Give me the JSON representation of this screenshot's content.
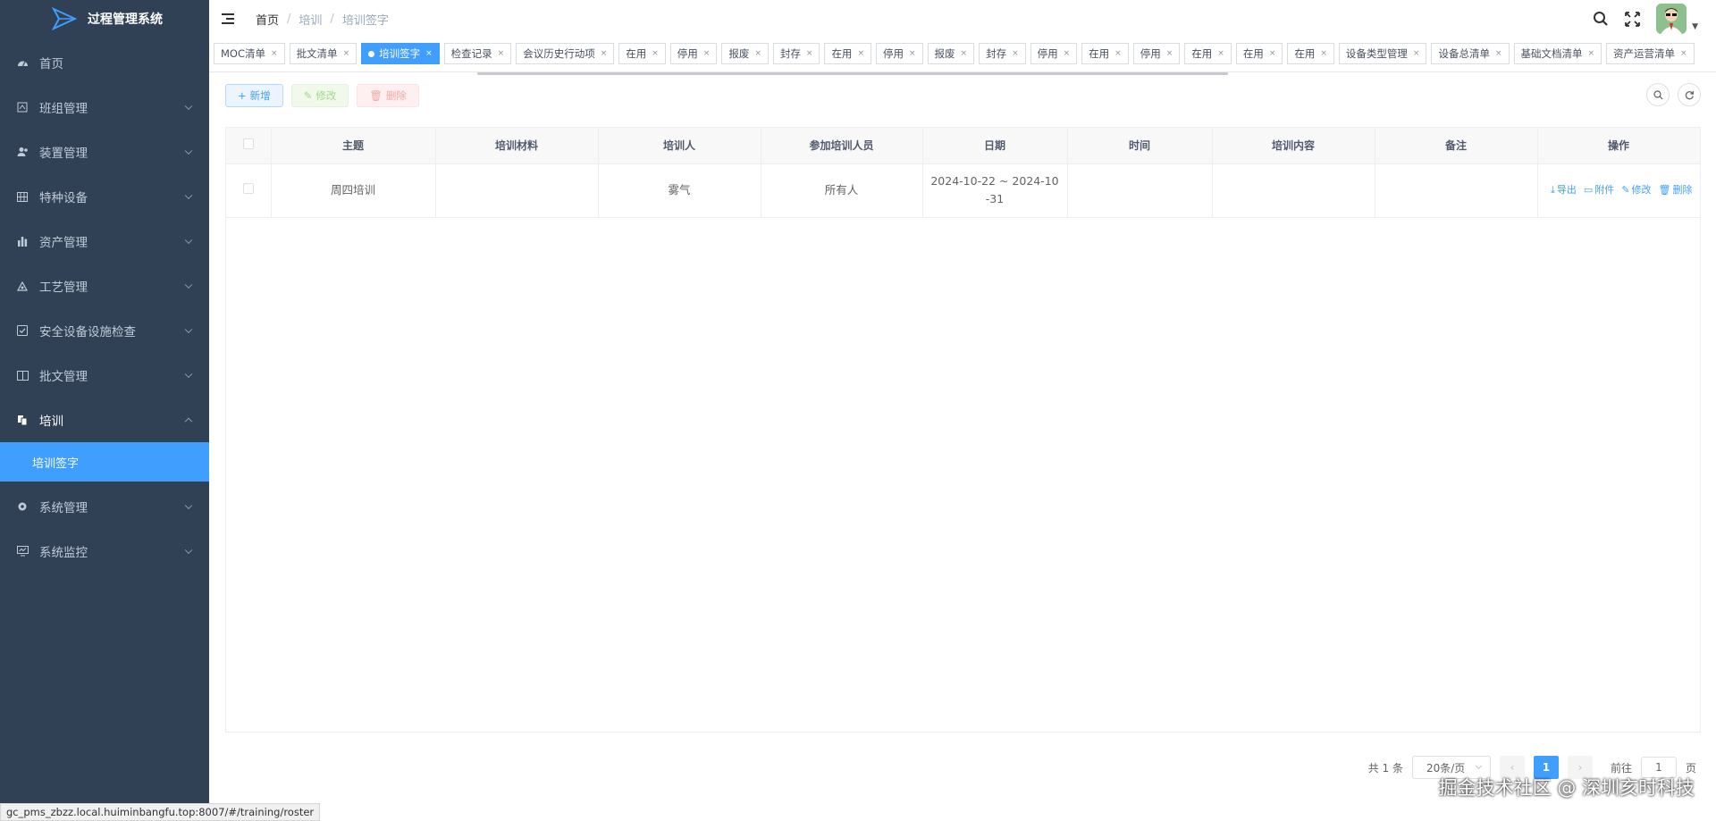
{
  "app": {
    "title": "过程管理系统"
  },
  "sidebar": {
    "items": [
      {
        "label": "首页",
        "icon": "dashboard-icon",
        "expandable": false
      },
      {
        "label": "班组管理",
        "icon": "team-icon",
        "expandable": true
      },
      {
        "label": "装置管理",
        "icon": "users-icon",
        "expandable": true
      },
      {
        "label": "特种设备",
        "icon": "grid-icon",
        "expandable": true
      },
      {
        "label": "资产管理",
        "icon": "bar-chart-icon",
        "expandable": true
      },
      {
        "label": "工艺管理",
        "icon": "process-icon",
        "expandable": true
      },
      {
        "label": "安全设备设施检查",
        "icon": "checkbox-icon",
        "expandable": true
      },
      {
        "label": "批文管理",
        "icon": "book-icon",
        "expandable": true
      },
      {
        "label": "培训",
        "icon": "training-icon",
        "expandable": true,
        "open": true
      },
      {
        "label": "系统管理",
        "icon": "gear-icon",
        "expandable": true
      },
      {
        "label": "系统监控",
        "icon": "monitor-icon",
        "expandable": true
      }
    ],
    "submenu": {
      "label": "培训签字"
    }
  },
  "breadcrumb": {
    "home": "首页",
    "mid": "培训",
    "current": "培训签字"
  },
  "tags": [
    {
      "label": "MOC清单"
    },
    {
      "label": "批文清单"
    },
    {
      "label": "培训签字",
      "active": true
    },
    {
      "label": "检查记录"
    },
    {
      "label": "会议历史行动项"
    },
    {
      "label": "在用"
    },
    {
      "label": "停用"
    },
    {
      "label": "报废"
    },
    {
      "label": "封存"
    },
    {
      "label": "在用"
    },
    {
      "label": "停用"
    },
    {
      "label": "报废"
    },
    {
      "label": "封存"
    },
    {
      "label": "停用"
    },
    {
      "label": "在用"
    },
    {
      "label": "停用"
    },
    {
      "label": "在用"
    },
    {
      "label": "在用"
    },
    {
      "label": "在用"
    },
    {
      "label": "设备类型管理"
    },
    {
      "label": "设备总清单"
    },
    {
      "label": "基础文档清单"
    },
    {
      "label": "资产运营清单"
    }
  ],
  "toolbar": {
    "add": "新增",
    "edit": "修改",
    "delete": "删除"
  },
  "table": {
    "headers": [
      "主题",
      "培训材料",
      "培训人",
      "参加培训人员",
      "日期",
      "时间",
      "培训内容",
      "备注",
      "操作"
    ],
    "rows": [
      {
        "subject": "周四培训",
        "material": "",
        "trainer": "雾气",
        "participants": "所有人",
        "date": "2024-10-22 ~ 2024-10-31",
        "time": "",
        "content": "",
        "remark": "",
        "ops": {
          "export": "导出",
          "attach": "附件",
          "edit": "修改",
          "delete": "删除"
        }
      }
    ]
  },
  "pager": {
    "total": "共 1 条",
    "size": "20条/页",
    "current": "1",
    "goto_prefix": "前往",
    "goto_value": "1",
    "goto_suffix": "页"
  },
  "watermark": "掘金技术社区 @ 深圳亥时科技",
  "status_url": "gc_pms_zbzz.local.huiminbangfu.top:8007/#/training/roster",
  "colors": {
    "sidebar": "#304156",
    "accent": "#409eff"
  }
}
